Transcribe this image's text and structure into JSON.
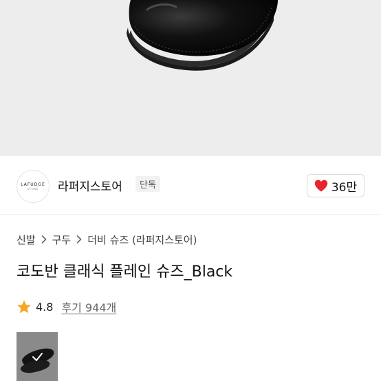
{
  "hero": {
    "image_icon": "black-derby-shoe-image"
  },
  "brand": {
    "logo_text": "LAFUDGE",
    "logo_subtext": "STORE",
    "name": "라퍼지스토어",
    "badge": "단독"
  },
  "like": {
    "icon": "heart-icon",
    "count": "36만",
    "color": "#e8242d"
  },
  "breadcrumb": {
    "items": [
      "신발",
      "구두",
      "더비 슈즈 (라퍼지스토어)"
    ]
  },
  "product": {
    "title": "코도반 클래식 플레인 슈즈_Black"
  },
  "rating": {
    "icon": "star-icon",
    "score": "4.8",
    "reviews": "후기 944개",
    "star_color": "#f5a623"
  },
  "thumbnail": {
    "icon": "check-icon",
    "selected": true
  }
}
